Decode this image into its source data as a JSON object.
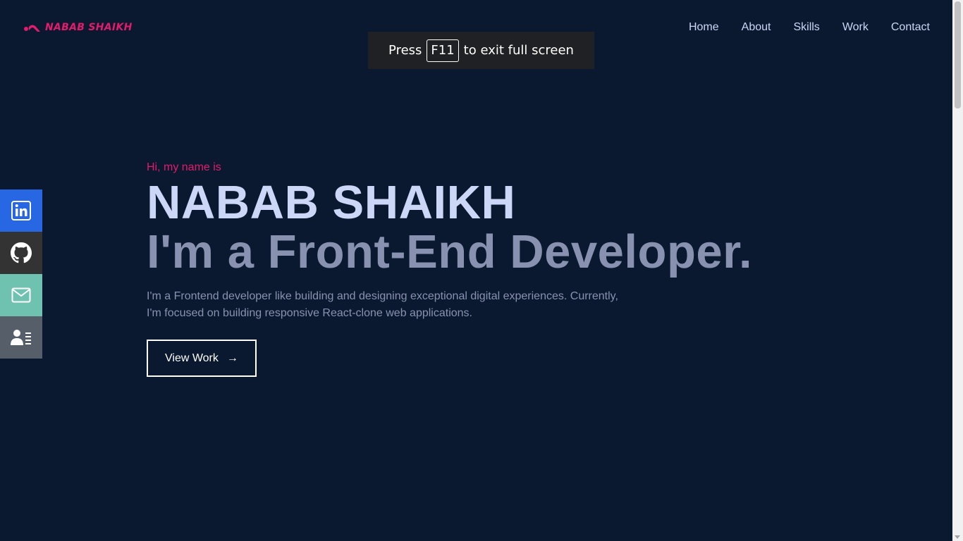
{
  "logo": {
    "text": "NABAB SHAIKH",
    "color": "#e31b6d"
  },
  "nav": {
    "items": [
      "Home",
      "About",
      "Skills",
      "Work",
      "Contact"
    ]
  },
  "fullscreen_notice": {
    "prefix": "Press",
    "key": "F11",
    "suffix": "to exit full screen"
  },
  "social": [
    {
      "icon": "linkedin-icon",
      "color": "#2867e4"
    },
    {
      "icon": "github-icon",
      "color": "#333333"
    },
    {
      "icon": "mail-icon",
      "color": "#6fc2b0"
    },
    {
      "icon": "resume-icon",
      "color": "#565f69"
    }
  ],
  "hero": {
    "intro": "Hi, my name is",
    "name": "NABAB SHAIKH",
    "tagline": "I'm a Front-End Developer.",
    "description_line1": "I'm a Frontend developer like building and designing exceptional digital experiences. Currently,",
    "description_line2": "I'm focused on building responsive React-clone web applications.",
    "cta_label": "View Work",
    "cta_arrow": "→"
  },
  "colors": {
    "background": "#0a192f",
    "accent": "#e31b6d",
    "heading": "#ccd6f6",
    "muted": "#8892b0"
  }
}
